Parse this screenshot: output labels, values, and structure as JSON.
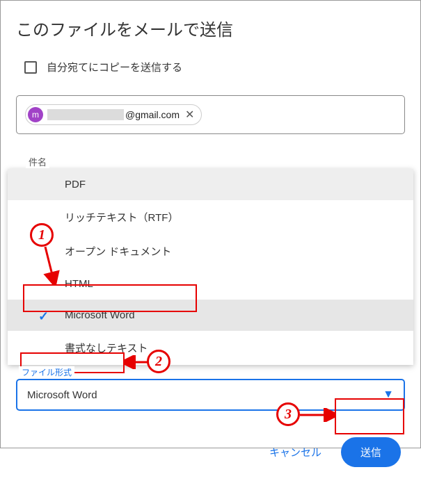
{
  "dialog": {
    "title": "このファイルをメールで送信",
    "copyToSelf": {
      "label": "自分宛てにコピーを送信する",
      "checked": false
    },
    "recipient": {
      "avatarLetter": "m",
      "domain": "@gmail.com"
    },
    "subjectLegend": "件名",
    "formatOptions": [
      {
        "label": "PDF",
        "state": "hover"
      },
      {
        "label": "リッチテキスト（RTF）",
        "state": "normal"
      },
      {
        "label": "オープン ドキュメント",
        "state": "normal"
      },
      {
        "label": "HTML",
        "state": "normal"
      },
      {
        "label": "Microsoft Word",
        "state": "selected"
      },
      {
        "label": "書式なしテキスト",
        "state": "normal"
      }
    ],
    "fileFormatLegend": "ファイル形式",
    "selectedFormat": "Microsoft Word",
    "buttons": {
      "cancel": "キャンセル",
      "send": "送信"
    }
  },
  "annotations": {
    "one": "1",
    "two": "2",
    "three": "3"
  }
}
